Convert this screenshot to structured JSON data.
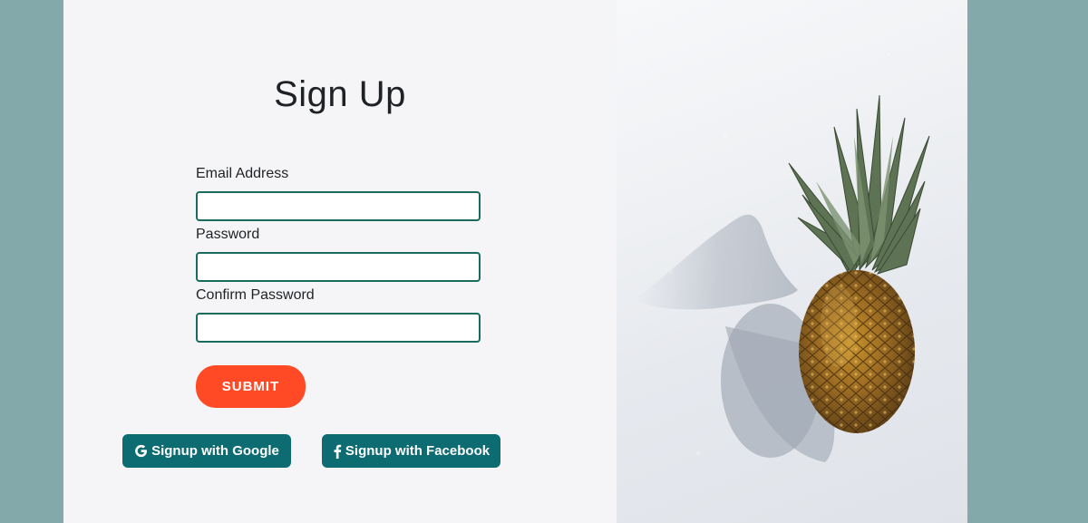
{
  "form": {
    "title": "Sign Up",
    "email": {
      "label": "Email Address",
      "value": "",
      "placeholder": ""
    },
    "password": {
      "label": "Password",
      "value": "",
      "placeholder": ""
    },
    "confirm_password": {
      "label": "Confirm Password",
      "value": "",
      "placeholder": ""
    },
    "submit_label": "SUBMIT"
  },
  "social": {
    "google_label": "Signup with Google",
    "google_icon": "google-g-icon",
    "facebook_label": "Signup with Facebook",
    "facebook_icon": "facebook-f-icon"
  },
  "image": {
    "subject": "pineapple-on-snow"
  },
  "colors": {
    "page_background": "#84a9ab",
    "form_background": "#f5f5f7",
    "input_border": "#1b6b5c",
    "submit": "#ff4a25",
    "social_button": "#0d6b72"
  }
}
